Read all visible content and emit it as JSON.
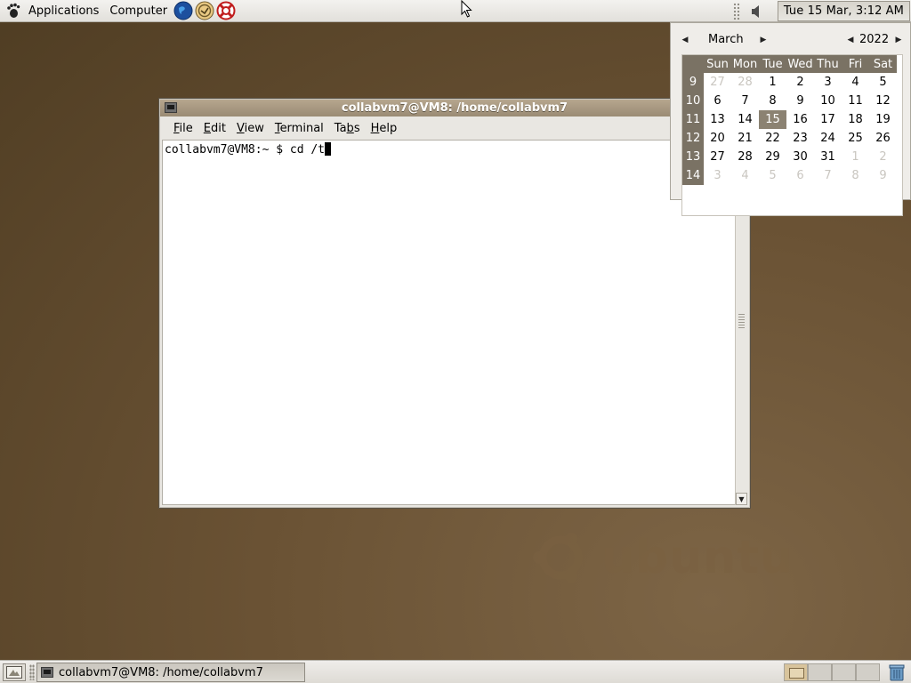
{
  "top_panel": {
    "applications_label": "Applications",
    "computer_label": "Computer",
    "clock_text": "Tue 15 Mar,  3:12 AM"
  },
  "terminal": {
    "title": "collabvm7@VM8: /home/collabvm7",
    "menus": [
      {
        "underline": "F",
        "rest": "ile"
      },
      {
        "underline": "E",
        "rest": "dit"
      },
      {
        "underline": "V",
        "rest": "iew"
      },
      {
        "underline": "T",
        "rest": "erminal"
      },
      {
        "pre": "Ta",
        "underline": "b",
        "rest": "s"
      },
      {
        "underline": "H",
        "rest": "elp"
      }
    ],
    "prompt": "collabvm7@VM8:~ $ cd /t"
  },
  "calendar": {
    "month": "March",
    "year": "2022",
    "weekday_headers": [
      "Sun",
      "Mon",
      "Tue",
      "Wed",
      "Thu",
      "Fri",
      "Sat"
    ],
    "weeks": [
      {
        "num": "9",
        "days": [
          "27",
          "28",
          "1",
          "2",
          "3",
          "4",
          "5"
        ],
        "other": [
          0,
          1
        ]
      },
      {
        "num": "10",
        "days": [
          "6",
          "7",
          "8",
          "9",
          "10",
          "11",
          "12"
        ],
        "other": []
      },
      {
        "num": "11",
        "days": [
          "13",
          "14",
          "15",
          "16",
          "17",
          "18",
          "19"
        ],
        "other": []
      },
      {
        "num": "12",
        "days": [
          "20",
          "21",
          "22",
          "23",
          "24",
          "25",
          "26"
        ],
        "other": []
      },
      {
        "num": "13",
        "days": [
          "27",
          "28",
          "29",
          "30",
          "31",
          "1",
          "2"
        ],
        "other": [
          5,
          6
        ]
      },
      {
        "num": "14",
        "days": [
          "3",
          "4",
          "5",
          "6",
          "7",
          "8",
          "9"
        ],
        "other": [
          0,
          1,
          2,
          3,
          4,
          5,
          6
        ]
      }
    ],
    "selected_day": "15"
  },
  "bottom_panel": {
    "task_label": "collabvm7@VM8: /home/collabvm7",
    "workspace_count": 4,
    "active_workspace": 1
  },
  "wallpaper_text": "ubuntu",
  "colors": {
    "desktop": "#6a5234",
    "titlebar": "#9a8b74",
    "calendar_header": "#7a7264",
    "calendar_selected": "#8b8272"
  },
  "icons": [
    "gnome-foot-icon",
    "web-browser-icon",
    "email-icon",
    "help-icon",
    "volume-icon",
    "terminal-icon",
    "show-desktop-icon",
    "trash-icon"
  ]
}
